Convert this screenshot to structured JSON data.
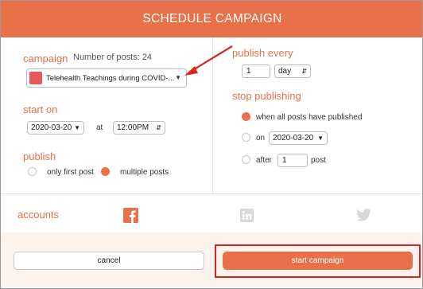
{
  "modal": {
    "title": "SCHEDULE CAMPAIGN"
  },
  "campaign": {
    "label": "campaign",
    "posts_count_text": "Number of posts: 24",
    "selected": "Telehealth Teachings during COVID-...",
    "swatch_color": "#e5585b"
  },
  "start_on": {
    "label": "start on",
    "date": "2020-03-20",
    "at_label": "at",
    "time": "12:00PM"
  },
  "publish": {
    "label": "publish",
    "options": [
      {
        "label": "only first post",
        "selected": false
      },
      {
        "label": "multiple posts",
        "selected": true
      }
    ]
  },
  "publish_every": {
    "label": "publish every",
    "value": "1",
    "unit": "day"
  },
  "stop_publishing": {
    "label": "stop publishing",
    "options": [
      {
        "label": "when all posts have published",
        "selected": true
      },
      {
        "label": "on",
        "selected": false,
        "date": "2020-03-20"
      },
      {
        "label": "after",
        "selected": false,
        "value": "1",
        "suffix": "post"
      }
    ]
  },
  "accounts": {
    "label": "accounts",
    "icons": [
      {
        "name": "facebook-icon",
        "active": true
      },
      {
        "name": "linkedin-icon",
        "active": false
      },
      {
        "name": "twitter-icon",
        "active": false
      }
    ]
  },
  "buttons": {
    "cancel": "cancel",
    "start": "start campaign"
  },
  "colors": {
    "accent": "#e8714a",
    "annotation_red": "#d9271f",
    "inactive_icon": "#d8d8d8"
  }
}
